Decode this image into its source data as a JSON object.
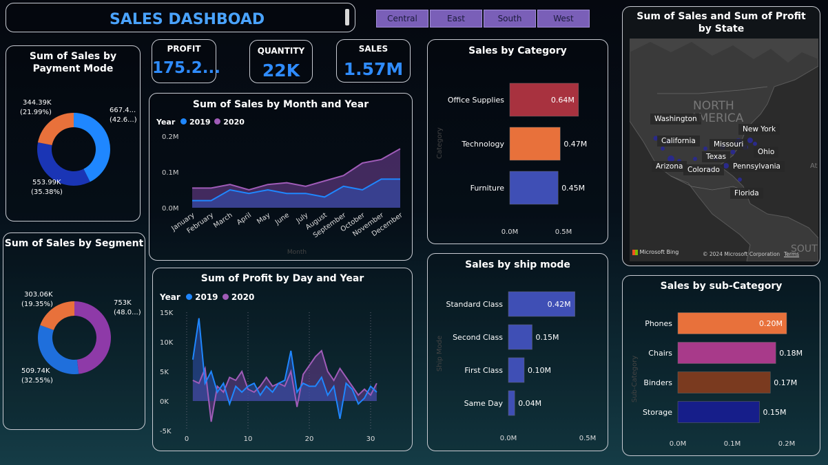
{
  "header": {
    "title": "SALES DASHBOAD"
  },
  "filters": {
    "regions": [
      "Central",
      "East",
      "South",
      "West"
    ]
  },
  "kpis": {
    "profit": {
      "label": "PROFIT",
      "value": "175.2..."
    },
    "quantity": {
      "label": "QUANTITY",
      "value": "22K"
    },
    "sales": {
      "label": "SALES",
      "value": "1.57M"
    }
  },
  "payment_mode": {
    "title": "Sum of Sales by Payment Mode",
    "labels": [
      {
        "value": "667.4...",
        "pct": "(42.6...)"
      },
      {
        "value": "553.99K",
        "pct": "(35.38%)"
      },
      {
        "value": "344.39K",
        "pct": "(21.99%)"
      }
    ],
    "colors": [
      "#1f87ff",
      "#1a35b5",
      "#e8713b"
    ]
  },
  "segment": {
    "title": "Sum of Sales by Segment",
    "labels": [
      {
        "value": "753K",
        "pct": "(48.0...)"
      },
      {
        "value": "509.74K",
        "pct": "(32.55%)"
      },
      {
        "value": "303.06K",
        "pct": "(19.35%)"
      }
    ],
    "colors": [
      "#8e3aa8",
      "#1f6fdc",
      "#e8713b"
    ]
  },
  "month_chart": {
    "title": "Sum of Sales by Month and Year",
    "legend_title": "Year",
    "y_ticks": [
      "0.2M",
      "0.1M",
      "0.0M"
    ],
    "x_title": "Month"
  },
  "day_chart": {
    "title": "Sum of Profit by Day and Year",
    "legend_title": "Year",
    "y_ticks": [
      "15K",
      "10K",
      "5K",
      "0K",
      "-5K"
    ],
    "x_ticks": [
      "0",
      "10",
      "20",
      "30"
    ]
  },
  "category": {
    "title": "Sales by Category",
    "axis_title": "Category",
    "x_ticks": [
      "0.0M",
      "0.5M"
    ],
    "colors": [
      "#a8323f",
      "#e8713b",
      "#3f4fb5"
    ]
  },
  "shipmode": {
    "title": "Sales by ship mode",
    "axis_title": "Ship Mode",
    "x_ticks": [
      "0.0M",
      "0.5M"
    ],
    "color": "#3f4fb5"
  },
  "subcategory": {
    "title": "Sales by sub-Category",
    "axis_title": "Sub-Category",
    "x_ticks": [
      "0.0M",
      "0.1M",
      "0.2M"
    ],
    "colors": [
      "#e8713b",
      "#a83a8a",
      "#7a3a1f",
      "#161e8a"
    ]
  },
  "map": {
    "title": "Sum of Sales and Sum of Profit by State",
    "continent_north": "NORTH",
    "continent_america": "AMERICA",
    "continent_south": "SOUTH",
    "ocean": "At",
    "bing": "Microsoft Bing",
    "copyright": "© 2024 Microsoft Corporation",
    "terms": "Terms",
    "states": [
      "Washington",
      "California",
      "Missouri",
      "New York",
      "Ohio",
      "Texas",
      "Pennsylvania",
      "Arizona",
      "Colorado",
      "Florida"
    ]
  },
  "chart_data": [
    {
      "type": "line",
      "title": "Sum of Sales by Month and Year",
      "xlabel": "Month",
      "ylabel": "",
      "categories": [
        "January",
        "February",
        "March",
        "April",
        "May",
        "June",
        "July",
        "August",
        "September",
        "October",
        "November",
        "December"
      ],
      "ylim": [
        0,
        0.2
      ],
      "series": [
        {
          "name": "2019",
          "color": "#1f87ff",
          "values": [
            0.02,
            0.02,
            0.05,
            0.04,
            0.05,
            0.04,
            0.04,
            0.03,
            0.06,
            0.05,
            0.08,
            0.08
          ]
        },
        {
          "name": "2020",
          "color": "#a05cb8",
          "values": [
            0.055,
            0.055,
            0.065,
            0.05,
            0.065,
            0.07,
            0.06,
            0.075,
            0.09,
            0.125,
            0.135,
            0.165
          ]
        }
      ]
    },
    {
      "type": "line",
      "title": "Sum of Profit by Day and Year",
      "xlabel": "",
      "ylabel": "",
      "ylim": [
        -5000,
        15000
      ],
      "x": [
        1,
        2,
        3,
        4,
        5,
        6,
        7,
        8,
        9,
        10,
        11,
        12,
        13,
        14,
        15,
        16,
        17,
        18,
        19,
        20,
        21,
        22,
        23,
        24,
        25,
        26,
        27,
        28,
        29,
        30,
        31
      ],
      "series": [
        {
          "name": "2019",
          "color": "#1f87ff",
          "values": [
            7000,
            14000,
            3000,
            5000,
            1500,
            3000,
            -500,
            2500,
            1500,
            2500,
            3000,
            1000,
            2500,
            1500,
            3000,
            3500,
            8500,
            1500,
            3000,
            2500,
            2500,
            4000,
            1000,
            2500,
            -3000,
            3000,
            2000,
            -500,
            500,
            2500,
            1500
          ]
        },
        {
          "name": "2020",
          "color": "#a05cb8",
          "values": [
            3500,
            3000,
            5500,
            -3500,
            2500,
            1500,
            4000,
            3500,
            5000,
            2000,
            1500,
            2500,
            4000,
            2500,
            3000,
            2500,
            5000,
            -1000,
            4500,
            6000,
            7500,
            8500,
            5000,
            3500,
            5500,
            4000,
            2500,
            1000,
            2000,
            1000,
            3000
          ]
        }
      ]
    },
    {
      "type": "bar",
      "title": "Sales by Category",
      "categories": [
        "Office Supplies",
        "Technology",
        "Furniture"
      ],
      "values": [
        0.64,
        0.47,
        0.45
      ],
      "value_labels": [
        "0.64M",
        "0.47M",
        "0.45M"
      ],
      "xlim": [
        0,
        0.75
      ]
    },
    {
      "type": "bar",
      "title": "Sales by ship mode",
      "categories": [
        "Standard Class",
        "Second Class",
        "First Class",
        "Same Day"
      ],
      "values": [
        0.42,
        0.15,
        0.1,
        0.04
      ],
      "value_labels": [
        "0.42M",
        "0.15M",
        "0.10M",
        "0.04M"
      ],
      "xlim": [
        0,
        0.5
      ]
    },
    {
      "type": "bar",
      "title": "Sales by sub-Category",
      "categories": [
        "Phones",
        "Chairs",
        "Binders",
        "Storage"
      ],
      "values": [
        0.2,
        0.18,
        0.17,
        0.15
      ],
      "value_labels": [
        "0.20M",
        "0.18M",
        "0.17M",
        "0.15M"
      ],
      "xlim": [
        0,
        0.2
      ]
    },
    {
      "type": "pie",
      "title": "Sum of Sales by Payment Mode",
      "categories": [
        "",
        "",
        ""
      ],
      "values": [
        667.4,
        553.99,
        344.39
      ]
    },
    {
      "type": "pie",
      "title": "Sum of Sales by Segment",
      "categories": [
        "",
        "",
        ""
      ],
      "values": [
        753,
        509.74,
        303.06
      ]
    }
  ]
}
